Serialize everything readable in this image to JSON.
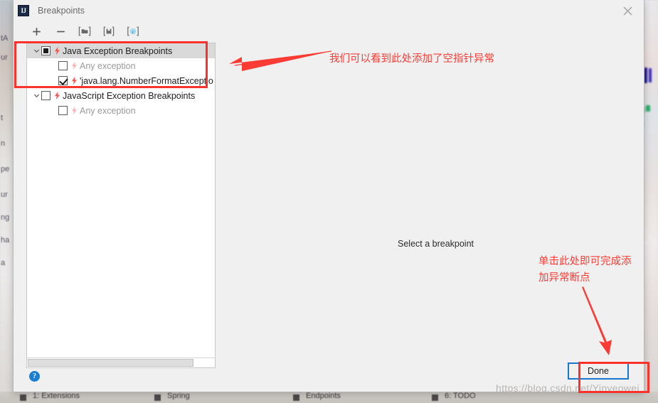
{
  "window": {
    "title": "Breakpoints",
    "app_icon": "intellij-idea-icon",
    "icon_text": "IJ",
    "close_label": "×"
  },
  "toolbar": {
    "items": [
      {
        "name": "add-breakpoint-button",
        "icon": "plus-icon",
        "glyph": "+"
      },
      {
        "name": "remove-breakpoint-button",
        "icon": "minus-icon",
        "glyph": "−"
      },
      {
        "name": "group-by-file-button",
        "icon": "folder-bracket-icon",
        "glyph": "[▰]"
      },
      {
        "name": "save-to-file-button",
        "icon": "disk-bracket-icon",
        "glyph": "[▯]"
      },
      {
        "name": "class-filter-button",
        "icon": "blue-circle-c-icon",
        "glyph": "[c]"
      }
    ]
  },
  "tree": {
    "rows": [
      {
        "label": "Java Exception Breakpoints",
        "level": 0,
        "expanded": true,
        "chevron": "chevron-down-icon",
        "checkbox": "partial",
        "bolt": true,
        "selected": true,
        "muted": false
      },
      {
        "label": "Any exception",
        "level": 1,
        "expanded": null,
        "chevron": "",
        "checkbox": "unchecked",
        "bolt": true,
        "selected": false,
        "muted": true
      },
      {
        "label": "'java.lang.NumberFormatExceptio",
        "level": 1,
        "expanded": null,
        "chevron": "",
        "checkbox": "checked",
        "bolt": true,
        "selected": false,
        "muted": false
      },
      {
        "label": "JavaScript Exception Breakpoints",
        "level": 0,
        "expanded": true,
        "chevron": "chevron-down-icon",
        "checkbox": "unchecked",
        "bolt": true,
        "selected": false,
        "muted": false
      },
      {
        "label": "Any exception",
        "level": 1,
        "expanded": null,
        "chevron": "",
        "checkbox": "unchecked",
        "bolt": true,
        "selected": false,
        "muted": true
      }
    ]
  },
  "detail_pane": {
    "empty_message": "Select a breakpoint"
  },
  "footer": {
    "help_label": "?",
    "done_label": "Done"
  },
  "annotations": {
    "note_tree": "我们可以看到此处添加了空指针异常",
    "note_done_line1": "单击此处即可完成添",
    "note_done_line2": "加异常断点",
    "accent_color": "#fb3b34",
    "highlight_color": "#f9322c"
  },
  "watermark": {
    "text": "https://blog.csdn.net/Yinyeowei"
  },
  "background": {
    "left_fragments": [
      "tA",
      "ur",
      "t",
      "n",
      "pe",
      "ur",
      "ng",
      "ha",
      "a"
    ],
    "status_items": [
      "1: Extensions",
      "Spring",
      "Endpoints",
      "6: TODO"
    ]
  },
  "colors": {
    "dialog_bg": "#f0f0f0",
    "tree_bg": "#ffffff",
    "selected_row": "#d9d9d9",
    "muted_text": "#9a9a9a",
    "bolt_red": "#f4564f",
    "button_border_blue": "#1878cf",
    "help_blue": "#1a7fd4"
  }
}
